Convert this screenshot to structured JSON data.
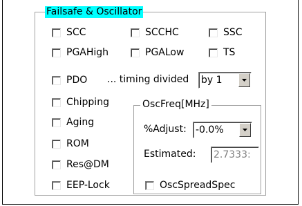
{
  "group": {
    "title": "Failsafe & Oscillator"
  },
  "checkboxes": {
    "scc": "SCC",
    "scchc": "SCCHC",
    "ssc": "SSC",
    "pgahigh": "PGAHigh",
    "pgalow": "PGALow",
    "ts": "TS",
    "pdo": "PDO",
    "chipping": "Chipping",
    "aging": "Aging",
    "rom": "ROM",
    "resdm": "Res@DM",
    "eeplock": "EEP-Lock",
    "oscspreadspec": "OscSpreadSpec"
  },
  "timing": {
    "label": "... timing divided",
    "selected": "by 1"
  },
  "osc": {
    "title": "OscFreq[MHz]",
    "adjust_label": "%Adjust:",
    "adjust_selected": "-0.0%",
    "estimated_label": "Estimated:",
    "estimated_value": "2.7333:"
  },
  "icons": {
    "dropdown": "chevron-down-icon"
  }
}
